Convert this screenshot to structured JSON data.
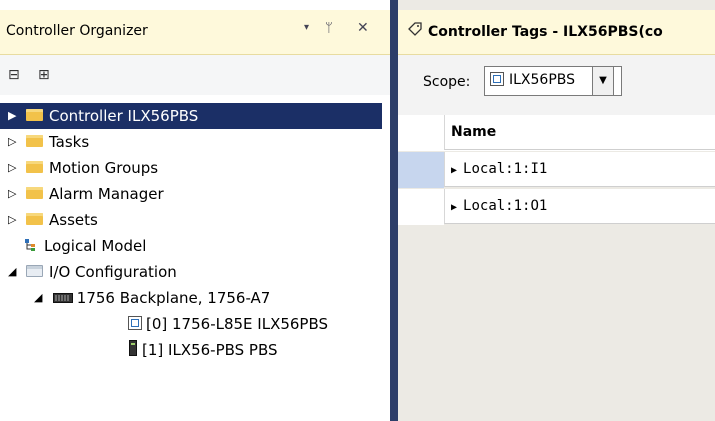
{
  "organizer": {
    "title": "Controller Organizer",
    "dropdown_glyph": "▾",
    "pin_glyph": "ᛘ",
    "close_glyph": "✕",
    "toolbar": {
      "collapse_icon": "⊟",
      "expand_icon": "⊞"
    },
    "tree": [
      {
        "label": "Controller ILX56PBS",
        "selected": true,
        "toggle": "▶"
      },
      {
        "label": "Tasks",
        "toggle": "▷"
      },
      {
        "label": "Motion Groups",
        "toggle": "▷"
      },
      {
        "label": "Alarm Manager",
        "toggle": "▷"
      },
      {
        "label": "Assets",
        "toggle": "▷"
      },
      {
        "label": "Logical Model"
      },
      {
        "label": "I/O Configuration",
        "toggle": "◢"
      },
      {
        "label": "1756 Backplane, 1756-A7",
        "toggle": "◢"
      },
      {
        "label": "[0] 1756-L85E ILX56PBS"
      },
      {
        "label": "[1] ILX56-PBS PBS"
      }
    ]
  },
  "tags": {
    "tab_title": "Controller Tags - ILX56PBS(co",
    "scope_label": "Scope:",
    "scope_value": "ILX56PBS",
    "column_header": "Name",
    "rows": [
      {
        "name": "Local:1:I1",
        "highlight": true
      },
      {
        "name": "Local:1:O1",
        "highlight": false
      }
    ]
  },
  "colors": {
    "selection": "#1b2f66",
    "tab_header": "#fef9db",
    "folder": "#f2c24a",
    "row_highlight": "#c7d6ee"
  }
}
